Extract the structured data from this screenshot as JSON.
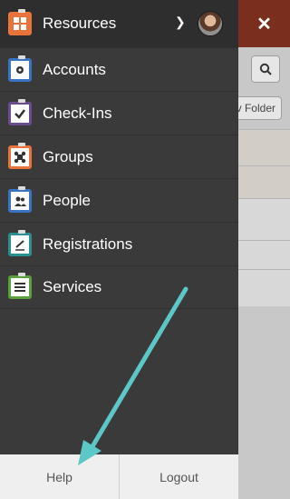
{
  "header": {
    "title": "Resources",
    "chevron_icon": "chevron-down-icon",
    "avatar_icon": "user-avatar"
  },
  "close_icon": "close-icon",
  "background": {
    "search_icon": "search-icon",
    "folder_button_label": "v Folder"
  },
  "menu": [
    {
      "label": "Accounts",
      "icon": "gear-icon",
      "color": "#3b73c4"
    },
    {
      "label": "Check-Ins",
      "icon": "checkmark-icon",
      "color": "#6a4d8f"
    },
    {
      "label": "Groups",
      "icon": "groups-icon",
      "color": "#e8743b"
    },
    {
      "label": "People",
      "icon": "people-icon",
      "color": "#3b73c4"
    },
    {
      "label": "Registrations",
      "icon": "pen-icon",
      "color": "#2a8f8f"
    },
    {
      "label": "Services",
      "icon": "list-icon",
      "color": "#5aa03c"
    }
  ],
  "footer": {
    "help_label": "Help",
    "logout_label": "Logout"
  },
  "colors": {
    "accent_arrow": "#5bc7c7",
    "resources_icon": "#e8743b"
  }
}
